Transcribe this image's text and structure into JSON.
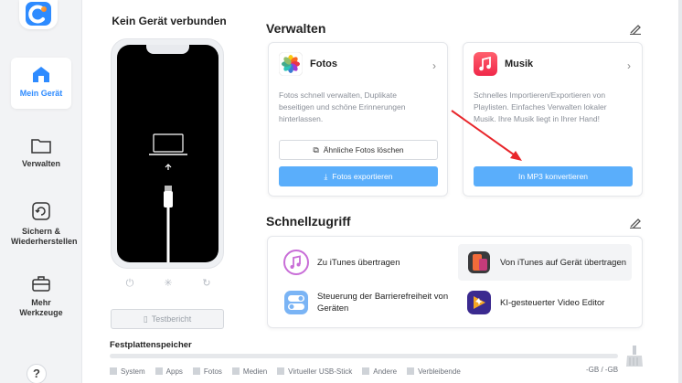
{
  "sidebar": {
    "items": [
      {
        "label": "Mein Gerät",
        "icon": "home-icon",
        "active": true
      },
      {
        "label": "Verwalten",
        "icon": "folder-icon"
      },
      {
        "label": "Sichern & Wiederherstellen",
        "icon": "backup-icon"
      },
      {
        "label": "Mehr Werkzeuge",
        "icon": "toolbox-icon"
      }
    ],
    "help": "?"
  },
  "device": {
    "title": "Kein Gerät verbunden",
    "report_label": "Testbericht"
  },
  "manage": {
    "title": "Verwalten",
    "photos": {
      "title": "Fotos",
      "desc": "Fotos schnell verwalten, Duplikate beseitigen und schöne Erinnerungen hinterlassen.",
      "btn_similar": "Ähnliche Fotos löschen",
      "btn_export": "Fotos exportieren"
    },
    "music": {
      "title": "Musik",
      "desc": "Schnelles Importieren/Exportieren von Playlisten. Einfaches Verwalten lokaler Musik. Ihre Musik liegt in Ihrer Hand!",
      "btn_convert": "In MP3 konvertieren"
    }
  },
  "quick": {
    "title": "Schnellzugriff",
    "items": [
      {
        "label": "Zu iTunes übertragen",
        "icon": "itunes-icon"
      },
      {
        "label": "Von iTunes auf Gerät übertragen",
        "icon": "device-transfer-icon"
      },
      {
        "label": "Steuerung der Barrierefreiheit von Geräten",
        "icon": "accessibility-toggle-icon"
      },
      {
        "label": "KI-gesteuerter Video Editor",
        "icon": "video-editor-icon"
      }
    ]
  },
  "storage": {
    "title": "Festplattenspeicher",
    "legend": [
      "System",
      "Apps",
      "Fotos",
      "Medien",
      "Virtueller USB-Stick",
      "Andere",
      "Verbleibende"
    ],
    "total": "-GB / -GB"
  },
  "colors": {
    "accent": "#2e8bff",
    "button_blue": "#5aaefb",
    "annotation_arrow": "#e8262b"
  }
}
